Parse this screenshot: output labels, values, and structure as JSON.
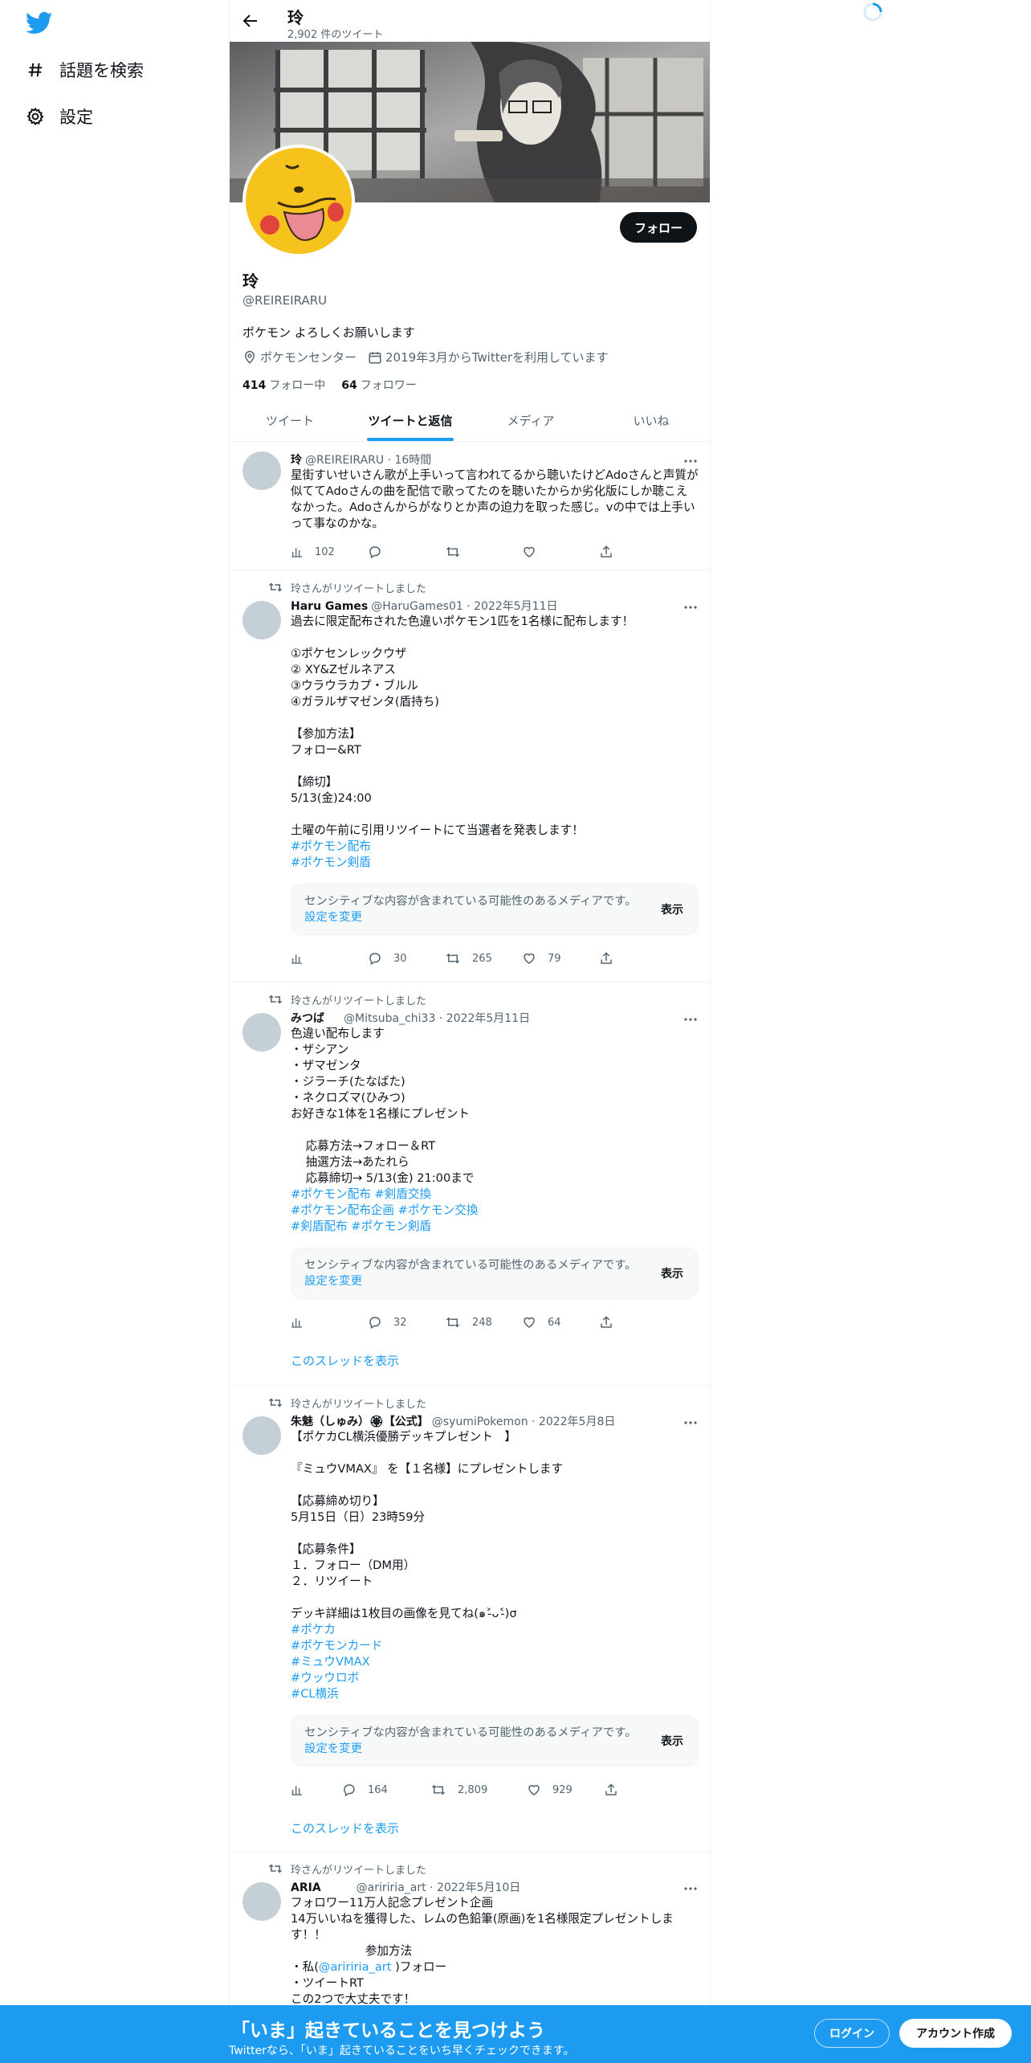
{
  "nav": {
    "explore_label": "話題を検索",
    "settings_label": "設定"
  },
  "header": {
    "name": "玲",
    "tweet_count": "2,902 件のツイート"
  },
  "profile": {
    "follow_label": "フォロー",
    "name": "玲",
    "handle": "@REIREIRARU",
    "bio": "ポケモン よろしくお願いします",
    "location": "ポケモンセンター",
    "joined": "2019年3月からTwitterを利用しています",
    "following_count": "414",
    "following_label": "フォロー中",
    "followers_count": "64",
    "followers_label": "フォロワー"
  },
  "tabs": [
    {
      "label": "ツイート"
    },
    {
      "label": "ツイートと返信"
    },
    {
      "label": "メディア"
    },
    {
      "label": "いいね"
    }
  ],
  "sensitive": {
    "text": "センシティブな内容が含まれている可能性のあるメディアです。",
    "link": "設定を変更",
    "show": "表示"
  },
  "thread_label": "このスレッドを表示",
  "retweet_label": "玲さんがリツイートしました",
  "tweets": [
    {
      "name": "玲",
      "handle": "@REIREIRARU · 16時間",
      "body": "星街すいせいさん歌が上手いって言われてるから聴いたけどAdoさんと声質が似ててAdoさんの曲を配信で歌ってたのを聴いたからか劣化版にしか聴こえなかった。Adoさんからがなりとか声の迫力を取った感じ。vの中では上手いって事なのかな。",
      "views": "102",
      "replies": "",
      "retweets": "",
      "likes": ""
    },
    {
      "name": "Haru Games",
      "handle": "@HaruGames01 · 2022年5月11日",
      "body": "過去に限定配布された色違いポケモン1匹を1名様に配布します！\n\n①ポケセンレックウザ\n② XY&Zゼルネアス\n③ウラウラカプ・ブルル\n④ガラルザマゼンタ(盾持ち)\n\n【参加方法】\nフォロー&RT\n\n【締切】\n5/13(金)24:00\n\n土曜の午前に引用リツイートにて当選者を発表します！\n",
      "tags": "#ポケモン配布\n#ポケモン剣盾",
      "views": "",
      "replies": "30",
      "retweets": "265",
      "likes": "79"
    },
    {
      "name": "みつば",
      "handle": "@Mitsuba_chi33 · 2022年5月11日",
      "body": "色違い配布します\n・ザシアン\n・ザマゼンタ\n・ジラーチ(たなばた)\n・ネクロズマ(ひみつ)\nお好きな1体を1名様にプレゼント\n\n    応募方法→フォロー＆RT\n    抽選方法→あたれら\n    応募締切→ 5/13(金) 21:00まで\n",
      "tags": "#ポケモン配布 #剣盾交換\n#ポケモン配布企画 #ポケモン交換\n#剣盾配布 #ポケモン剣盾",
      "views": "",
      "replies": "32",
      "retweets": "248",
      "likes": "64"
    },
    {
      "name": "朱魅（しゅみ）🏵【公式】",
      "handle": "@syumiPokemon · 2022年5月8日",
      "body": "【ポケカCL横浜優勝デッキプレゼント　】\n\n『ミュウVMAX』 を【１名様】にプレゼントします\n\n【応募締め切り】\n5月15日（日）23時59分\n\n【応募条件】\n１．フォロー（DM用）\n２．リツイート\n\nデッキ詳細は1枚目の画像を見てね(๑˃̵ᴗ˂̵)σ\n",
      "tags": "#ポケカ\n#ポケモンカード\n#ミュウVMAX\n#ウッウロボ\n#CL横浜",
      "views": "",
      "replies": "164",
      "retweets": "2,809",
      "likes": "929"
    },
    {
      "name": "ARIA",
      "handle": "@aririria_art · 2022年5月10日",
      "body_1": "フォロワー11万人記念プレゼント企画\n14万いいねを獲得した、レムの色鉛筆(原画)を1名様限定プレゼントします！！\n                    参加方法\n・私(",
      "mention": "@aririria_art",
      "body_2": " )フォロー\n・ツイートRT\nこの2つで大丈夫です！"
    }
  ],
  "bottom": {
    "headline": "「いま」起きていることを見つけよう",
    "sub": "Twitterなら、「いま」起きていることをいち早くチェックできます。",
    "login": "ログイン",
    "signup": "アカウント作成"
  },
  "colors": {
    "accent": "#1d9bf0",
    "text": "#0f1419",
    "muted": "#536471"
  }
}
